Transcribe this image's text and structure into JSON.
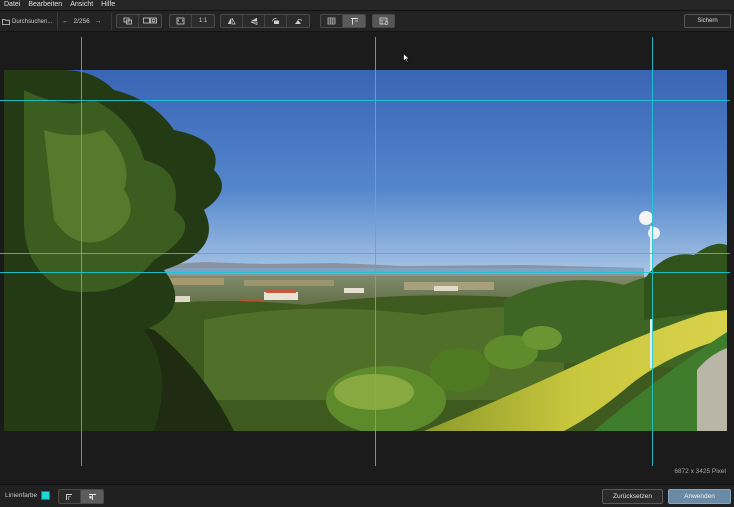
{
  "menu": {
    "items": [
      {
        "label": "Datei"
      },
      {
        "label": "Bearbeiten"
      },
      {
        "label": "Ansicht"
      },
      {
        "label": "Hilfe"
      }
    ]
  },
  "toolbar": {
    "browse_label": "Durchsuchen...",
    "image_counter": "2/256",
    "zoom_label": "1:1",
    "save_label": "Sichern"
  },
  "image_info": {
    "dimensions": "6872 x 3425 Pixel"
  },
  "bottom": {
    "line_color_label": "Linienfarbe",
    "line_color": "#1fd6de",
    "reset_label": "Zurücksetzen",
    "apply_label": "Anwenden"
  },
  "colors": {
    "accent": "#6b8aa6",
    "guide_line": "#1bc9d4"
  }
}
